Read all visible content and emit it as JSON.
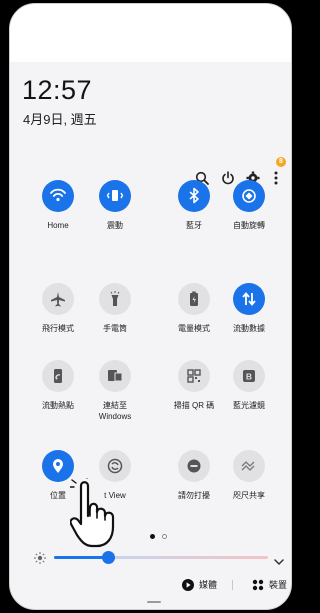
{
  "clock": {
    "time": "12:57",
    "date": "4月9日, 週五"
  },
  "header_icons": [
    "search-icon",
    "power-icon",
    "gear-icon",
    "more-vert-icon"
  ],
  "notification_badge": "8",
  "tiles": [
    {
      "label": "Home",
      "icon": "wifi-icon",
      "state": "on"
    },
    {
      "label": "震動",
      "icon": "vibrate-icon",
      "state": "on"
    },
    {
      "label": "藍牙",
      "icon": "bluetooth-icon",
      "state": "on"
    },
    {
      "label": "自動旋轉",
      "icon": "auto-rotate-icon",
      "state": "on"
    },
    {
      "label": "飛行模式",
      "icon": "airplane-icon",
      "state": "off"
    },
    {
      "label": "手電筒",
      "icon": "flashlight-icon",
      "state": "off"
    },
    {
      "label": "電量模式",
      "icon": "battery-mode-icon",
      "state": "off"
    },
    {
      "label": "流動數據",
      "icon": "mobile-data-icon",
      "state": "on"
    },
    {
      "label": "流動熱點",
      "icon": "hotspot-icon",
      "state": "off"
    },
    {
      "label": "連結至\nWindows",
      "icon": "link-windows-icon",
      "state": "off"
    },
    {
      "label": "掃描 QR 碼",
      "icon": "qr-scan-icon",
      "state": "off"
    },
    {
      "label": "藍光濾鏡",
      "icon": "blue-light-filter-icon",
      "state": "off"
    },
    {
      "label": "位置",
      "icon": "location-icon",
      "state": "on"
    },
    {
      "label": "t View",
      "icon": "smart-view-icon",
      "state": "off"
    },
    {
      "label": "請勿打擾",
      "icon": "do-not-disturb-icon",
      "state": "off"
    },
    {
      "label": "咫尺共享",
      "icon": "nearby-share-icon",
      "state": "off"
    }
  ],
  "pager": {
    "current": 1,
    "total": 2
  },
  "brightness": {
    "level": 0.2
  },
  "bottom": {
    "media_label": "媒體",
    "devices_label": "裝置"
  },
  "colors": {
    "accent": "#1a73e8",
    "tile_off": "#e1e1e4",
    "panel_bg": "#f4f4f6",
    "badge": "#f5a623"
  }
}
